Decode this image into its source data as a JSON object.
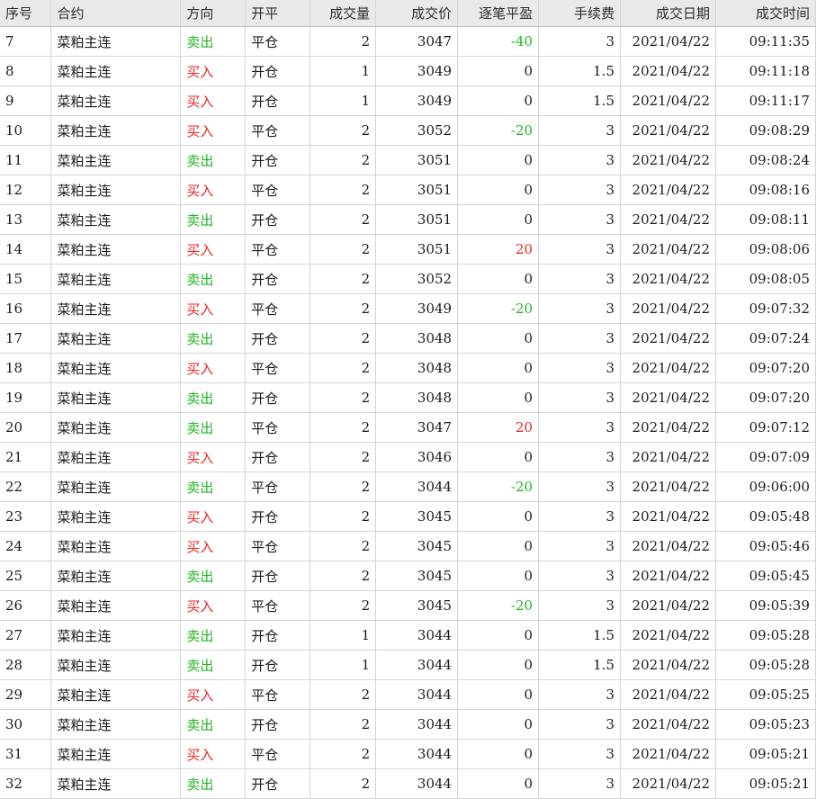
{
  "colors": {
    "buy": "#ee2222",
    "sell": "#22b422",
    "header_bg": "#e9e9e9",
    "grid_line": "#d4d4d4"
  },
  "headers": [
    "序号",
    "合约",
    "方向",
    "开平",
    "成交量",
    "成交价",
    "逐笔平盈",
    "手续费",
    "成交日期",
    "成交时间"
  ],
  "rows": [
    {
      "id": "7",
      "contract": "菜粕主连",
      "dir": "卖出",
      "oc": "平仓",
      "vol": "2",
      "price": "3047",
      "pnl": "-40",
      "fee": "3",
      "date": "2021/04/22",
      "time": "09:11:35"
    },
    {
      "id": "8",
      "contract": "菜粕主连",
      "dir": "买入",
      "oc": "开仓",
      "vol": "1",
      "price": "3049",
      "pnl": "0",
      "fee": "1.5",
      "date": "2021/04/22",
      "time": "09:11:18"
    },
    {
      "id": "9",
      "contract": "菜粕主连",
      "dir": "买入",
      "oc": "开仓",
      "vol": "1",
      "price": "3049",
      "pnl": "0",
      "fee": "1.5",
      "date": "2021/04/22",
      "time": "09:11:17"
    },
    {
      "id": "10",
      "contract": "菜粕主连",
      "dir": "买入",
      "oc": "平仓",
      "vol": "2",
      "price": "3052",
      "pnl": "-20",
      "fee": "3",
      "date": "2021/04/22",
      "time": "09:08:29"
    },
    {
      "id": "11",
      "contract": "菜粕主连",
      "dir": "卖出",
      "oc": "开仓",
      "vol": "2",
      "price": "3051",
      "pnl": "0",
      "fee": "3",
      "date": "2021/04/22",
      "time": "09:08:24"
    },
    {
      "id": "12",
      "contract": "菜粕主连",
      "dir": "买入",
      "oc": "平仓",
      "vol": "2",
      "price": "3051",
      "pnl": "0",
      "fee": "3",
      "date": "2021/04/22",
      "time": "09:08:16"
    },
    {
      "id": "13",
      "contract": "菜粕主连",
      "dir": "卖出",
      "oc": "开仓",
      "vol": "2",
      "price": "3051",
      "pnl": "0",
      "fee": "3",
      "date": "2021/04/22",
      "time": "09:08:11"
    },
    {
      "id": "14",
      "contract": "菜粕主连",
      "dir": "买入",
      "oc": "平仓",
      "vol": "2",
      "price": "3051",
      "pnl": "20",
      "fee": "3",
      "date": "2021/04/22",
      "time": "09:08:06"
    },
    {
      "id": "15",
      "contract": "菜粕主连",
      "dir": "卖出",
      "oc": "开仓",
      "vol": "2",
      "price": "3052",
      "pnl": "0",
      "fee": "3",
      "date": "2021/04/22",
      "time": "09:08:05"
    },
    {
      "id": "16",
      "contract": "菜粕主连",
      "dir": "买入",
      "oc": "平仓",
      "vol": "2",
      "price": "3049",
      "pnl": "-20",
      "fee": "3",
      "date": "2021/04/22",
      "time": "09:07:32"
    },
    {
      "id": "17",
      "contract": "菜粕主连",
      "dir": "卖出",
      "oc": "开仓",
      "vol": "2",
      "price": "3048",
      "pnl": "0",
      "fee": "3",
      "date": "2021/04/22",
      "time": "09:07:24"
    },
    {
      "id": "18",
      "contract": "菜粕主连",
      "dir": "买入",
      "oc": "平仓",
      "vol": "2",
      "price": "3048",
      "pnl": "0",
      "fee": "3",
      "date": "2021/04/22",
      "time": "09:07:20"
    },
    {
      "id": "19",
      "contract": "菜粕主连",
      "dir": "卖出",
      "oc": "开仓",
      "vol": "2",
      "price": "3048",
      "pnl": "0",
      "fee": "3",
      "date": "2021/04/22",
      "time": "09:07:20"
    },
    {
      "id": "20",
      "contract": "菜粕主连",
      "dir": "卖出",
      "oc": "平仓",
      "vol": "2",
      "price": "3047",
      "pnl": "20",
      "fee": "3",
      "date": "2021/04/22",
      "time": "09:07:12"
    },
    {
      "id": "21",
      "contract": "菜粕主连",
      "dir": "买入",
      "oc": "开仓",
      "vol": "2",
      "price": "3046",
      "pnl": "0",
      "fee": "3",
      "date": "2021/04/22",
      "time": "09:07:09"
    },
    {
      "id": "22",
      "contract": "菜粕主连",
      "dir": "卖出",
      "oc": "平仓",
      "vol": "2",
      "price": "3044",
      "pnl": "-20",
      "fee": "3",
      "date": "2021/04/22",
      "time": "09:06:00"
    },
    {
      "id": "23",
      "contract": "菜粕主连",
      "dir": "买入",
      "oc": "开仓",
      "vol": "2",
      "price": "3045",
      "pnl": "0",
      "fee": "3",
      "date": "2021/04/22",
      "time": "09:05:48"
    },
    {
      "id": "24",
      "contract": "菜粕主连",
      "dir": "买入",
      "oc": "平仓",
      "vol": "2",
      "price": "3045",
      "pnl": "0",
      "fee": "3",
      "date": "2021/04/22",
      "time": "09:05:46"
    },
    {
      "id": "25",
      "contract": "菜粕主连",
      "dir": "卖出",
      "oc": "开仓",
      "vol": "2",
      "price": "3045",
      "pnl": "0",
      "fee": "3",
      "date": "2021/04/22",
      "time": "09:05:45"
    },
    {
      "id": "26",
      "contract": "菜粕主连",
      "dir": "买入",
      "oc": "平仓",
      "vol": "2",
      "price": "3045",
      "pnl": "-20",
      "fee": "3",
      "date": "2021/04/22",
      "time": "09:05:39"
    },
    {
      "id": "27",
      "contract": "菜粕主连",
      "dir": "卖出",
      "oc": "开仓",
      "vol": "1",
      "price": "3044",
      "pnl": "0",
      "fee": "1.5",
      "date": "2021/04/22",
      "time": "09:05:28"
    },
    {
      "id": "28",
      "contract": "菜粕主连",
      "dir": "卖出",
      "oc": "开仓",
      "vol": "1",
      "price": "3044",
      "pnl": "0",
      "fee": "1.5",
      "date": "2021/04/22",
      "time": "09:05:28"
    },
    {
      "id": "29",
      "contract": "菜粕主连",
      "dir": "买入",
      "oc": "平仓",
      "vol": "2",
      "price": "3044",
      "pnl": "0",
      "fee": "3",
      "date": "2021/04/22",
      "time": "09:05:25"
    },
    {
      "id": "30",
      "contract": "菜粕主连",
      "dir": "卖出",
      "oc": "开仓",
      "vol": "2",
      "price": "3044",
      "pnl": "0",
      "fee": "3",
      "date": "2021/04/22",
      "time": "09:05:23"
    },
    {
      "id": "31",
      "contract": "菜粕主连",
      "dir": "买入",
      "oc": "平仓",
      "vol": "2",
      "price": "3044",
      "pnl": "0",
      "fee": "3",
      "date": "2021/04/22",
      "time": "09:05:21"
    },
    {
      "id": "32",
      "contract": "菜粕主连",
      "dir": "卖出",
      "oc": "开仓",
      "vol": "2",
      "price": "3044",
      "pnl": "0",
      "fee": "3",
      "date": "2021/04/22",
      "time": "09:05:21"
    }
  ]
}
